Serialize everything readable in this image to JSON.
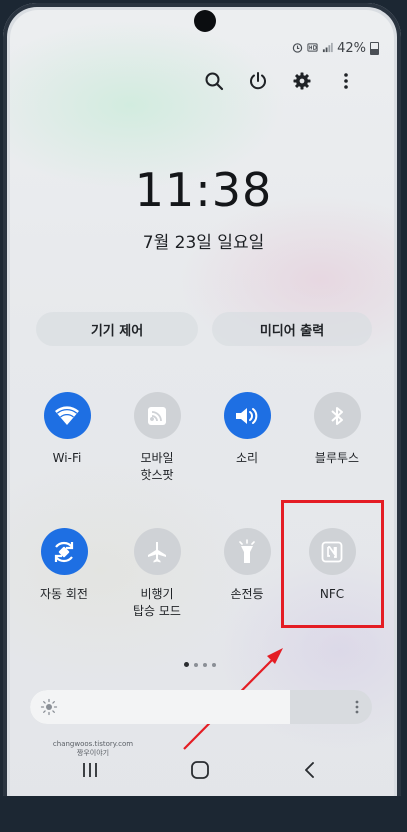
{
  "status_bar": {
    "battery_text": "42%",
    "icons": [
      "alarm-icon",
      "hd-voice-icon",
      "signal-icon",
      "battery-icon"
    ]
  },
  "toolbar": {
    "icons": [
      "search-icon",
      "power-icon",
      "settings-gear-icon",
      "more-vertical-icon"
    ]
  },
  "clock": {
    "time": "11:38",
    "date": "7월 23일 일요일"
  },
  "buttons": {
    "device_control": "기기 제어",
    "media_output": "미디어 출력"
  },
  "tiles": [
    {
      "label": "Wi-Fi",
      "state": "on",
      "icon": "wifi-icon"
    },
    {
      "label": "모바일\n핫스팟",
      "state": "off",
      "icon": "mobile-hotspot-icon"
    },
    {
      "label": "소리",
      "state": "on",
      "icon": "sound-icon"
    },
    {
      "label": "블루투스",
      "state": "off",
      "icon": "bluetooth-icon"
    },
    {
      "label": "자동 회전",
      "state": "on",
      "icon": "auto-rotate-icon"
    },
    {
      "label": "비행기\n탑승 모드",
      "state": "off",
      "icon": "airplane-mode-icon"
    },
    {
      "label": "손전등",
      "state": "off",
      "icon": "flashlight-icon"
    },
    {
      "label": "NFC",
      "state": "off",
      "icon": "nfc-icon"
    }
  ],
  "pager": {
    "pages": 4,
    "current": 1
  },
  "brightness": {
    "level": 0.76
  },
  "watermark": {
    "line1": "changwoos.tistory.com",
    "line2": "짱우이야기"
  },
  "navbar": {
    "icons": [
      "recent-apps-icon",
      "home-icon",
      "back-icon"
    ]
  },
  "colors": {
    "accent": "#1e6fe3",
    "highlight": "#e41d24",
    "tile_off": "#cfd2d6"
  }
}
